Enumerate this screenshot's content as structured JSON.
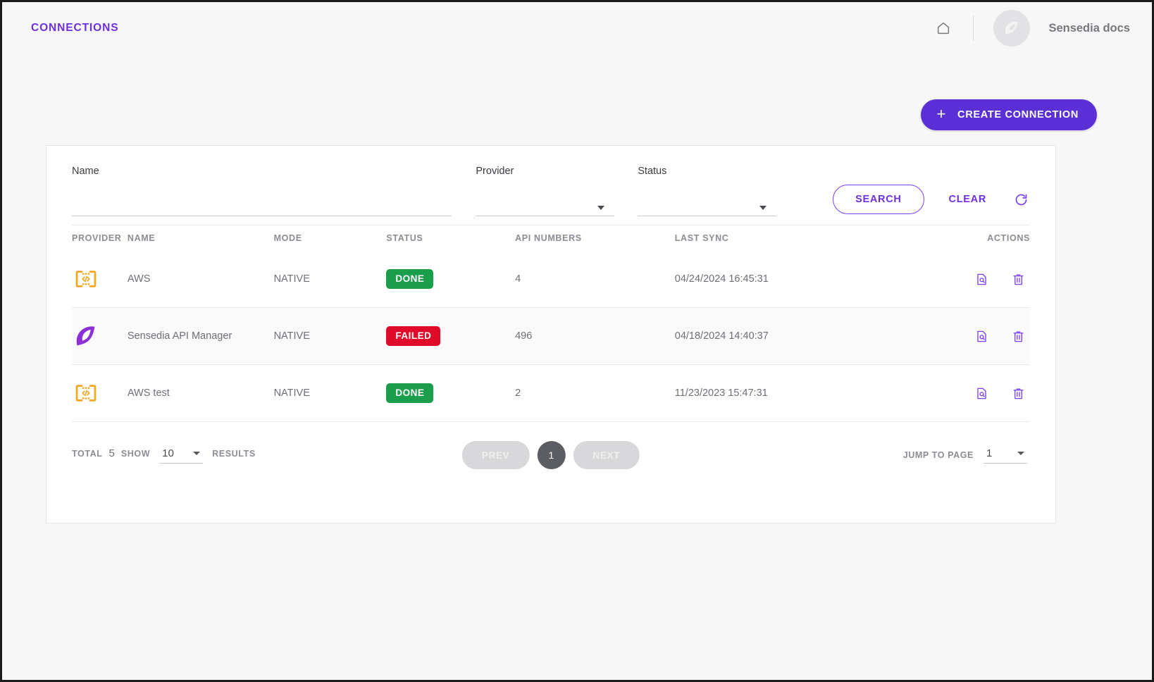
{
  "header": {
    "title": "CONNECTIONS",
    "home_icon": "home-icon",
    "avatar_icon": "sensedia-logo-icon",
    "user_name": "Sensedia docs"
  },
  "toolbar": {
    "create_label": "CREATE CONNECTION",
    "create_icon": "plus-icon",
    "create_color": "#5b2fd6"
  },
  "filters": {
    "name": {
      "label": "Name",
      "value": "",
      "placeholder": ""
    },
    "provider": {
      "label": "Provider",
      "value": "",
      "caret_icon": "chevron-down-icon"
    },
    "status": {
      "label": "Status",
      "value": "",
      "caret_icon": "chevron-down-icon"
    },
    "search_label": "SEARCH",
    "clear_label": "CLEAR",
    "refresh_icon": "refresh-icon",
    "accent_color": "#6f2fe0"
  },
  "table": {
    "columns": [
      "PROVIDER",
      "NAME",
      "MODE",
      "STATUS",
      "API NUMBERS",
      "LAST SYNC",
      "ACTIONS"
    ],
    "rows": [
      {
        "provider_icon": "aws-api-gateway-icon",
        "name": "AWS",
        "mode": "NATIVE",
        "status": "DONE",
        "status_color": "#1a9e4b",
        "api_numbers": "4",
        "last_sync": "04/24/2024 16:45:31",
        "view_icon": "document-search-icon",
        "delete_icon": "trash-icon"
      },
      {
        "provider_icon": "sensedia-logo-icon",
        "name": "Sensedia API Manager",
        "mode": "NATIVE",
        "status": "FAILED",
        "status_color": "#e00a2b",
        "api_numbers": "496",
        "last_sync": "04/18/2024 14:40:37",
        "view_icon": "document-search-icon",
        "delete_icon": "trash-icon"
      },
      {
        "provider_icon": "aws-api-gateway-icon",
        "name": "AWS test",
        "mode": "NATIVE",
        "status": "DONE",
        "status_color": "#1a9e4b",
        "api_numbers": "2",
        "last_sync": "11/23/2023 15:47:31",
        "view_icon": "document-search-icon",
        "delete_icon": "trash-icon"
      }
    ]
  },
  "footer": {
    "total_label": "TOTAL",
    "total_value": "5",
    "show_label": "SHOW",
    "page_size": "10",
    "results_label": "RESULTS",
    "prev_label": "PREV",
    "current_page": "1",
    "next_label": "NEXT",
    "jump_label": "JUMP TO PAGE",
    "jump_value": "1"
  }
}
